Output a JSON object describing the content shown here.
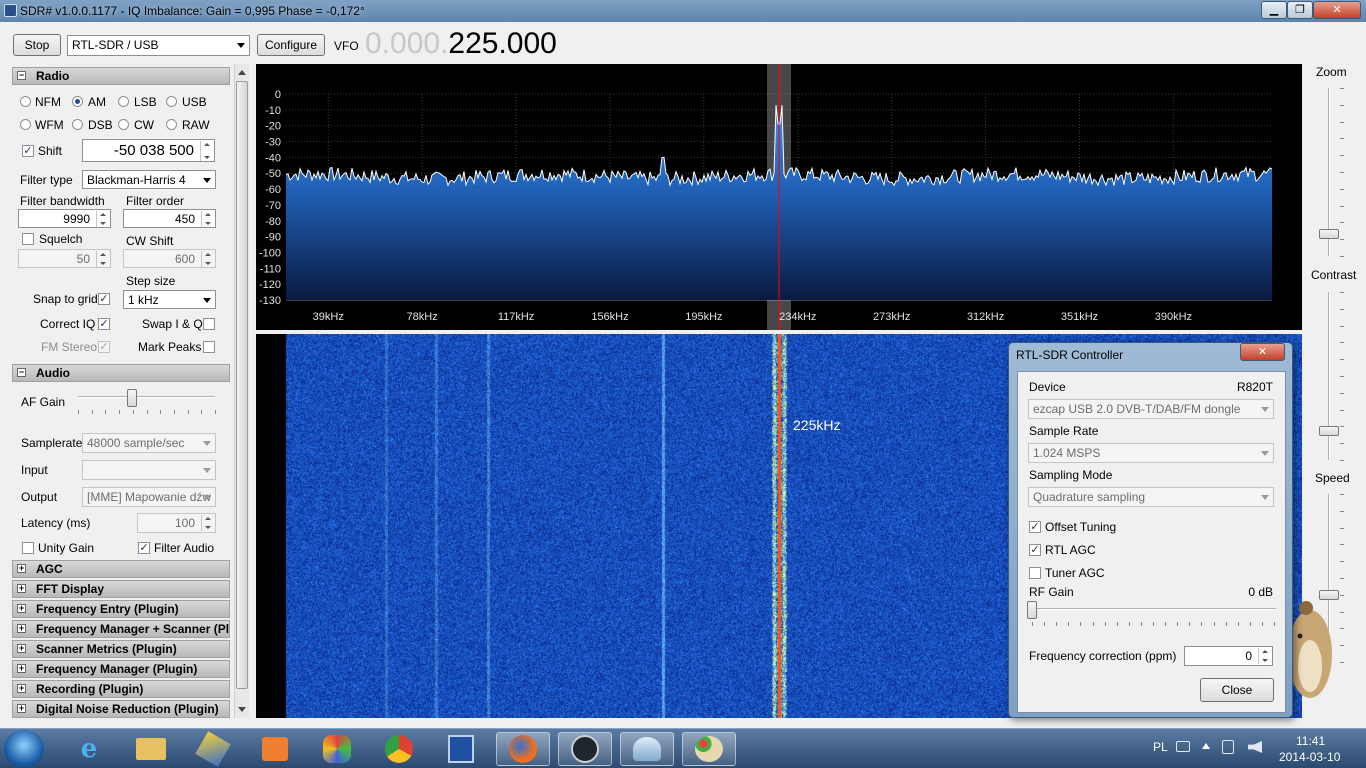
{
  "window": {
    "title": "SDR# v1.0.0.1177 - IQ Imbalance: Gain = 0,995 Phase = -0,172°",
    "minimize": "▁",
    "maximize": "❐",
    "close": "✕"
  },
  "toolbar": {
    "stop_label": "Stop",
    "source": "RTL-SDR / USB",
    "configure_label": "Configure",
    "vfo_label": "VFO",
    "vfo_dim": "0.000.",
    "vfo_main": "225.000"
  },
  "radio": {
    "header": "Radio",
    "modes": [
      "NFM",
      "AM",
      "LSB",
      "USB",
      "WFM",
      "DSB",
      "CW",
      "RAW"
    ],
    "selected_mode": "AM",
    "shift_label": "Shift",
    "shift_value": "-50 038 500",
    "filter_type_label": "Filter type",
    "filter_type": "Blackman-Harris 4",
    "filter_bandwidth_label": "Filter bandwidth",
    "filter_bandwidth": "9990",
    "filter_order_label": "Filter order",
    "filter_order": "450",
    "squelch_label": "Squelch",
    "squelch_value": "50",
    "cw_shift_label": "CW Shift",
    "cw_shift_value": "600",
    "step_size_label": "Step size",
    "step_size": "1 kHz",
    "snap_label": "Snap to grid",
    "correct_iq_label": "Correct IQ",
    "swap_iq_label": "Swap I & Q",
    "fm_stereo_label": "FM Stereo",
    "mark_peaks_label": "Mark Peaks"
  },
  "audio": {
    "header": "Audio",
    "af_gain_label": "AF Gain",
    "af_gain_level": 0.4,
    "samplerate_label": "Samplerate",
    "samplerate": "48000 sample/sec",
    "input_label": "Input",
    "input": "",
    "output_label": "Output",
    "output": "[MME] Mapowanie dźw",
    "latency_label": "Latency (ms)",
    "latency": "100",
    "unity_gain_label": "Unity Gain",
    "filter_audio_label": "Filter Audio"
  },
  "plugins": [
    "AGC",
    "FFT Display",
    "Frequency Entry (Plugin)",
    "Frequency Manager + Scanner (Plug",
    "Scanner Metrics (Plugin)",
    "Frequency Manager (Plugin)",
    "Recording (Plugin)",
    "Digital Noise Reduction (Plugin)"
  ],
  "spectrum": {
    "y_ticks": [
      "0",
      "-10",
      "-20",
      "-30",
      "-40",
      "-50",
      "-60",
      "-70",
      "-80",
      "-90",
      "-100",
      "-110",
      "-120",
      "-130"
    ],
    "x_ticks": [
      "39kHz",
      "78kHz",
      "117kHz",
      "156kHz",
      "195kHz",
      "234kHz",
      "273kHz",
      "312kHz",
      "351kHz",
      "390kHz"
    ]
  },
  "waterfall": {
    "marker_label": "225kHz"
  },
  "right_sliders": {
    "zoom_label": "Zoom",
    "contrast_label": "Contrast",
    "speed_label": "Speed"
  },
  "dialog": {
    "title": "RTL-SDR Controller",
    "close_x": "✕",
    "device_label": "Device",
    "device_tuner": "R820T",
    "device": "ezcap USB 2.0 DVB-T/DAB/FM dongle",
    "sample_rate_label": "Sample Rate",
    "sample_rate": "1.024 MSPS",
    "sampling_mode_label": "Sampling Mode",
    "sampling_mode": "Quadrature sampling",
    "offset_tuning_label": "Offset Tuning",
    "rtl_agc_label": "RTL AGC",
    "tuner_agc_label": "Tuner AGC",
    "rf_gain_label": "RF Gain",
    "rf_gain_value": "0 dB",
    "freq_corr_label": "Frequency correction (ppm)",
    "freq_corr": "0",
    "close_label": "Close"
  },
  "taskbar": {
    "lang": "PL",
    "time": "11:41",
    "date": "2014-03-10"
  },
  "colors": {
    "title_bar": "#6b8fb6",
    "spectrum_fill": "#2a6fc8",
    "waterfall_bg": "#1a3aa8",
    "vfo_line": "#ff0000",
    "taskbar": "#3a5a80"
  }
}
